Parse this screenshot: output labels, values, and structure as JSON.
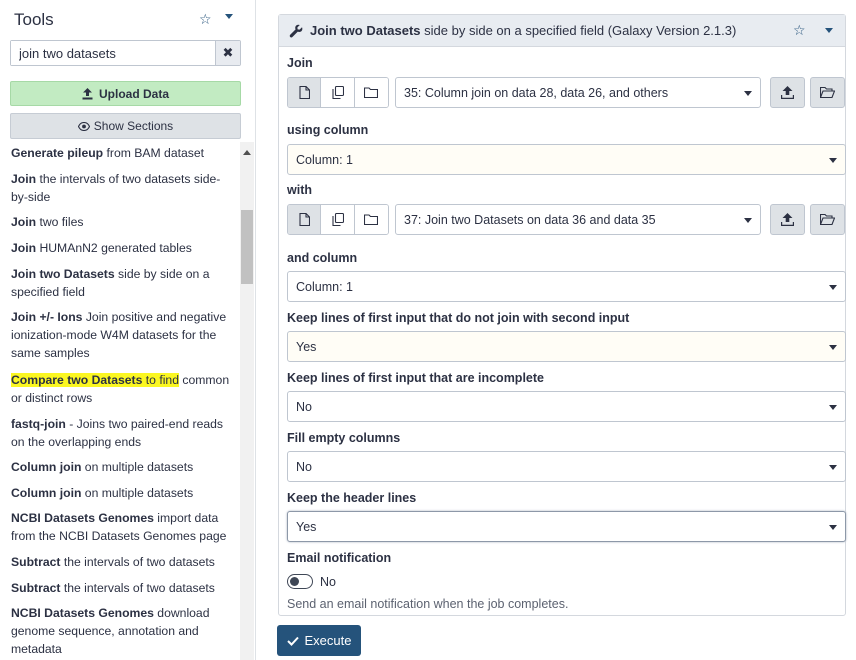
{
  "tool_panel": {
    "title": "Tools",
    "search": {
      "value": "join two datasets",
      "clear_label": "✖"
    },
    "upload_label": "Upload Data",
    "sections_label": "Show Sections",
    "items": [
      {
        "bold": "Generate pileup",
        "rest": " from BAM dataset"
      },
      {
        "bold": "Join",
        "rest": " the intervals of two datasets side-by-side"
      },
      {
        "bold": "Join",
        "rest": " two files"
      },
      {
        "bold": "Join",
        "rest": " HUMAnN2 generated tables"
      },
      {
        "bold": "Join two Datasets",
        "rest": " side by side on a specified field"
      },
      {
        "bold": "Join +/- Ions",
        "rest": " Join positive and negative ionization-mode W4M datasets for the same samples"
      },
      {
        "bold": "Compare two Datasets",
        "hl_rest": " to find",
        "rest": " common or distinct rows"
      },
      {
        "bold": "fastq-join",
        "rest": " - Joins two paired-end reads on the overlapping ends"
      },
      {
        "bold": "Column join",
        "rest": " on multiple datasets"
      },
      {
        "bold": "Column join",
        "rest": " on multiple datasets"
      },
      {
        "bold": "NCBI Datasets Genomes",
        "rest": " import data from the NCBI Datasets Genomes page"
      },
      {
        "bold": "Subtract",
        "rest": " the intervals of two datasets"
      },
      {
        "bold": "Subtract",
        "rest": " the intervals of two datasets"
      },
      {
        "bold": "NCBI Datasets Genomes",
        "rest": " download genome sequence, annotation and metadata"
      }
    ]
  },
  "form": {
    "title_bold": "Join two Datasets",
    "title_rest": " side by side on a specified field (Galaxy Version 2.1.3)",
    "join_label": "Join",
    "join_value": "35: Column join on data 28, data 26, and others",
    "using_column_label": "using column",
    "using_column_value": "Column: 1",
    "with_label": "with",
    "with_value": "37: Join two Datasets on data 36 and data 35",
    "and_column_label": "and column",
    "and_column_value": "Column: 1",
    "keep_no_join_label": "Keep lines of first input that do not join with second input",
    "keep_no_join_value": "Yes",
    "keep_incomplete_label": "Keep lines of first input that are incomplete",
    "keep_incomplete_value": "No",
    "fill_empty_label": "Fill empty columns",
    "fill_empty_value": "No",
    "header_label": "Keep the header lines",
    "header_value": "Yes",
    "email_label": "Email notification",
    "email_toggle_value": "No",
    "email_help": "Send an email notification when the job completes.",
    "execute_label": "Execute"
  },
  "colors": {
    "upload_bg": "#c2ebc2",
    "execute_bg": "#25537b",
    "highlight": "#fbf722"
  }
}
